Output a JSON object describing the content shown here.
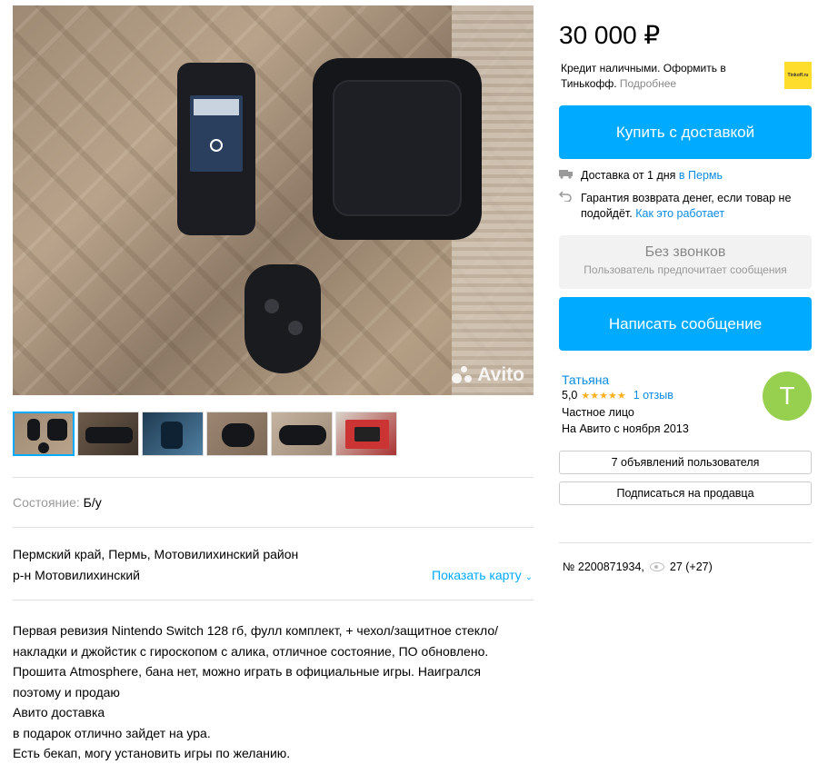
{
  "listing": {
    "price": "30 000 ₽",
    "photo_watermark": "Avito",
    "condition_label": "Состояние:",
    "condition_value": "Б/у",
    "address_line1": "Пермский край, Пермь, Мотовилихинский район",
    "address_line2": "р-н Мотовилихинский",
    "show_map": "Показать карту",
    "description": [
      "Первая ревизия Nintendo Switch 128 гб, фулл комплект, + чехол/защитное стекло/",
      "накладки и джойстик с гироскопом с алика, отличное состояние, ПО обновлено.",
      "Прошита Atmosphere, бана нет, можно играть в официальные игры. Наигрался",
      "поэтому и продаю",
      "Авито доставка",
      "в подарок отлично зайдет на ура.",
      "Есть бекап, могу установить игры по желанию."
    ],
    "item_number": "№ 2200871934,",
    "views": "27 (+27)"
  },
  "credit": {
    "text": "Кредит наличными. Оформить в Тинькофф.",
    "more_link": "Подробнее",
    "logo_text": "Tinkoff.ru"
  },
  "actions": {
    "buy_delivery": "Купить с доставкой",
    "delivery_text": "Доставка от 1 дня",
    "delivery_city": "в Пермь",
    "guarantee_text": "Гарантия возврата денег, если товар не подойдёт.",
    "guarantee_link": "Как это работает",
    "no_calls_title": "Без звонков",
    "no_calls_sub": "Пользователь предпочитает сообщения",
    "write_message": "Написать сообщение"
  },
  "seller": {
    "name": "Татьяна",
    "rating": "5,0",
    "stars": "★★★★★",
    "reviews": "1 отзыв",
    "type": "Частное лицо",
    "since": "На Авито с ноября 2013",
    "avatar_letter": "T",
    "all_ads": "7 объявлений пользователя",
    "subscribe": "Подписаться на продавца"
  },
  "colors": {
    "accent": "#00aaff",
    "link": "#0a8ce0",
    "avatar": "#97cf4f",
    "stars": "#ffb021"
  }
}
